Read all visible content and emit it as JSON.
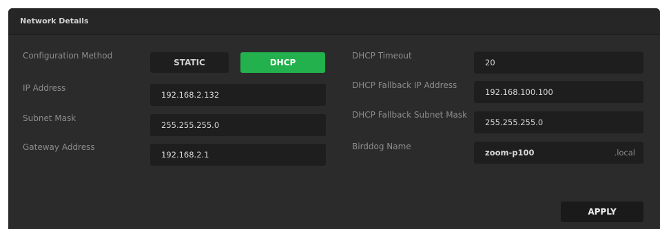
{
  "panel": {
    "title": "Network Details"
  },
  "left": {
    "configuration_method_label": "Configuration Method",
    "mode_options": [
      {
        "label": "STATIC",
        "selected": false
      },
      {
        "label": "DHCP",
        "selected": true
      }
    ],
    "ip_address_label": "IP Address",
    "ip_address_value": "192.168.2.132",
    "subnet_mask_label": "Subnet Mask",
    "subnet_mask_value": "255.255.255.0",
    "gateway_label": "Gateway Address",
    "gateway_value": "192.168.2.1"
  },
  "right": {
    "dhcp_timeout_label": "DHCP Timeout",
    "dhcp_timeout_value": "20",
    "fallback_ip_label": "DHCP Fallback IP Address",
    "fallback_ip_value": "192.168.100.100",
    "fallback_subnet_label": "DHCP Fallback Subnet Mask",
    "fallback_subnet_value": "255.255.255.0",
    "birddog_name_label": "Birddog Name",
    "birddog_name_value": "zoom-p100",
    "birddog_name_suffix": ".local"
  },
  "actions": {
    "apply_label": "APPLY"
  },
  "colors": {
    "panel_bg": "#2b2b2b",
    "field_bg": "#1e1e1e",
    "accent_green": "#22b14c",
    "label_text": "#8c8c8c",
    "value_text": "#d8d8d8"
  }
}
